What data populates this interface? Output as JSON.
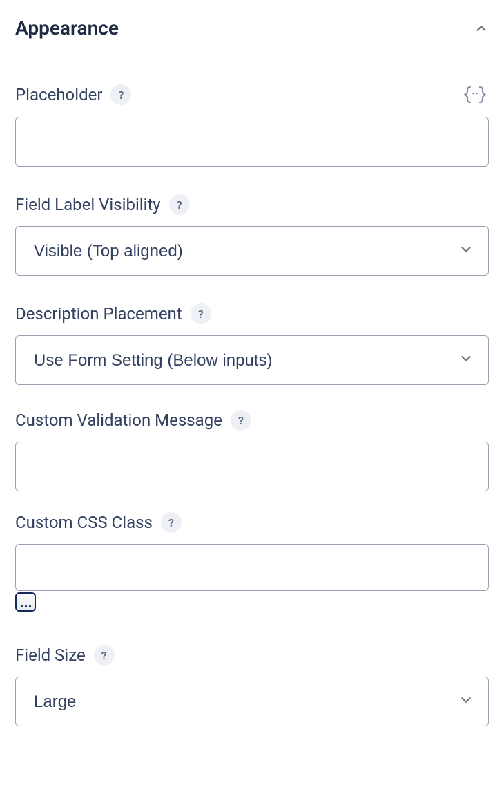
{
  "section": {
    "title": "Appearance"
  },
  "placeholder_field": {
    "label": "Placeholder",
    "value": ""
  },
  "label_visibility": {
    "label": "Field Label Visibility",
    "value": "Visible (Top aligned)"
  },
  "description_placement": {
    "label": "Description Placement",
    "value": "Use Form Setting (Below inputs)"
  },
  "custom_validation": {
    "label": "Custom Validation Message",
    "value": ""
  },
  "custom_css_class": {
    "label": "Custom CSS Class",
    "value": ""
  },
  "field_size": {
    "label": "Field Size",
    "value": "Large"
  },
  "help_glyph": "?"
}
